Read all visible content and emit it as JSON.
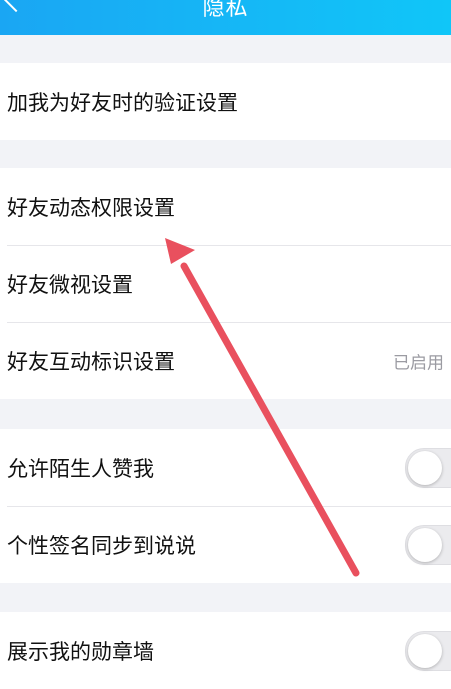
{
  "header": {
    "title": "隐私",
    "back_icon": "chevron-left-icon"
  },
  "sections": [
    {
      "rows": [
        {
          "label": "加我为好友时的验证设置"
        }
      ]
    },
    {
      "rows": [
        {
          "label": "好友动态权限设置"
        },
        {
          "label": "好友微视设置"
        },
        {
          "label": "好友互动标识设置",
          "value": "已启用"
        }
      ]
    },
    {
      "rows": [
        {
          "label": "允许陌生人赞我",
          "toggle_on": false
        },
        {
          "label": "个性签名同步到说说",
          "toggle_on": false
        }
      ]
    },
    {
      "rows": [
        {
          "label": "展示我的勋章墙",
          "toggle_on": false
        }
      ]
    }
  ],
  "colors": {
    "header_start": "#1aa6f3",
    "header_end": "#10c6f8",
    "annotation_arrow": "#e9505e",
    "background": "#f2f3f7"
  }
}
